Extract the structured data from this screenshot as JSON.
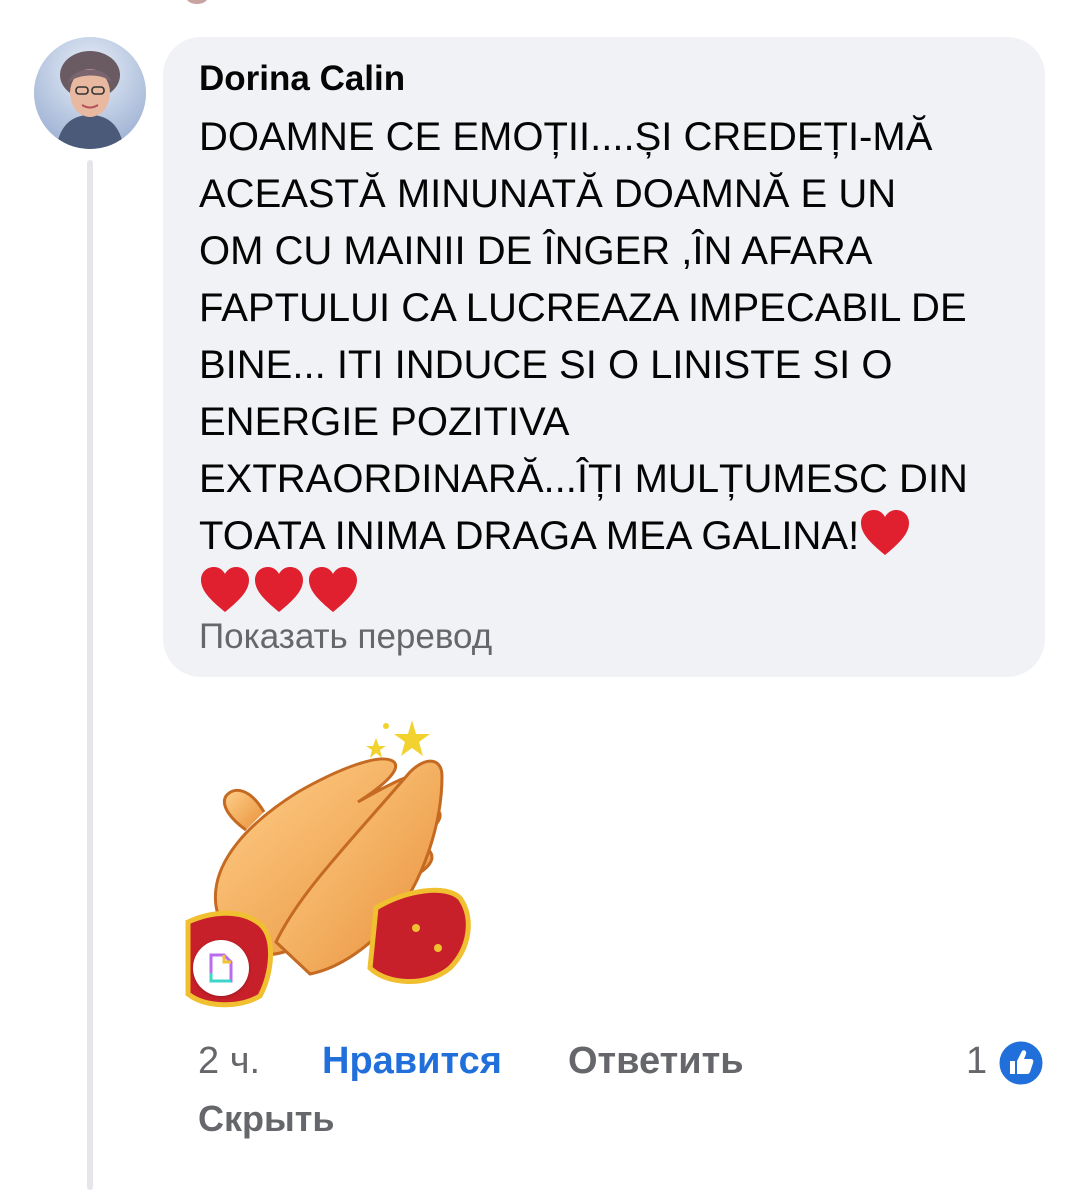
{
  "comment": {
    "author": "Dorina Calin",
    "text_lines": [
      "DOAMNE CE EMOȚII....ȘI CREDEȚI-MĂ",
      "ACEASTĂ MINUNATĂ DOAMNĂ E UN",
      "OM CU MAINII DE ÎNGER ,ÎN AFARA",
      "FAPTULUI CA LUCREAZA IMPECABIL DE",
      "BINE... ITI INDUCE SI O LINISTE SI O",
      "ENERGIE POZITIVA",
      "EXTRAORDINARĂ...ÎȚI MULȚUMESC DIN",
      "TOATA INIMA DRAGA MEA GALINA!"
    ],
    "translate_label": "Показать перевод",
    "sticker_icon": "clapping-hands-sticker",
    "heart_icon": "red-heart-emoji",
    "heart_color": "#e0202f"
  },
  "actions": {
    "time": "2 ч.",
    "like_label": "Нравится",
    "reply_label": "Ответить",
    "like_count": "1",
    "hide_label": "Скрыть"
  },
  "colors": {
    "bubble": "#f0f2f5",
    "like_blue": "#216fdb",
    "secondary_text": "#65676b"
  }
}
